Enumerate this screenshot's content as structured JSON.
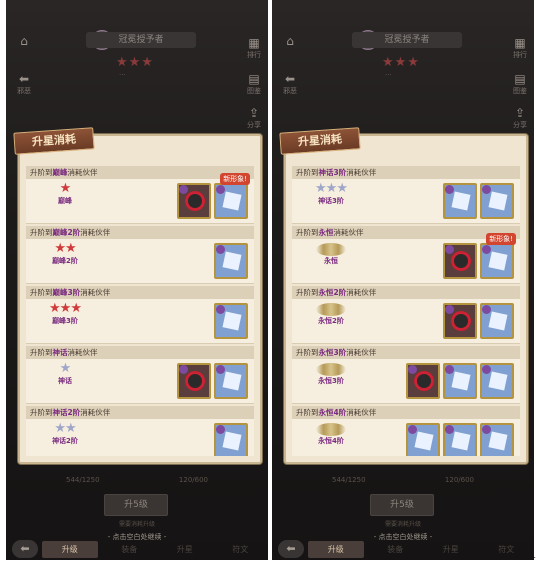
{
  "left": {
    "top_title": "冠冕授予者",
    "side_left": [
      {
        "label": "邪恶"
      }
    ],
    "side_right": [
      {
        "label": "排行"
      },
      {
        "label": "图鉴"
      },
      {
        "label": "分享"
      }
    ],
    "card_title": "升星消耗",
    "rows": [
      {
        "prefix": "升阶到",
        "rank": "巅峰",
        "suffix": "消耗伙伴",
        "stars": "★",
        "star_type": "red",
        "name": "巅峰",
        "slots": [
          "dark",
          "blue"
        ],
        "new": "新形象!"
      },
      {
        "prefix": "升阶到",
        "rank": "巅峰2阶",
        "suffix": "消耗伙伴",
        "stars": "★★",
        "star_type": "red",
        "name": "巅峰2阶",
        "slots": [
          "blue"
        ],
        "new": ""
      },
      {
        "prefix": "升阶到",
        "rank": "巅峰3阶",
        "suffix": "消耗伙伴",
        "stars": "★★★",
        "star_type": "red",
        "name": "巅峰3阶",
        "slots": [
          "blue"
        ],
        "new": ""
      },
      {
        "prefix": "升阶到",
        "rank": "神话",
        "suffix": "消耗伙伴",
        "stars": "★",
        "star_type": "silver",
        "name": "神话",
        "slots": [
          "dark",
          "blue"
        ],
        "new": ""
      },
      {
        "prefix": "升阶到",
        "rank": "神话2阶",
        "suffix": "消耗伙伴",
        "stars": "★★",
        "star_type": "silver",
        "name": "神话2阶",
        "slots": [
          "blue"
        ],
        "new": ""
      }
    ],
    "currency": [
      "544/1250",
      "120/600"
    ],
    "upgrade_label": "升5级",
    "hint": "需要消耗升级",
    "dismiss": "- 点击空白处继续 -",
    "tabs": [
      "升级",
      "装备",
      "升星",
      "符文"
    ]
  },
  "right": {
    "top_title": "冠冕授予者",
    "side_left": [
      {
        "label": "邪恶"
      }
    ],
    "side_right": [
      {
        "label": "排行"
      },
      {
        "label": "图鉴"
      },
      {
        "label": "分享"
      }
    ],
    "card_title": "升星消耗",
    "rows": [
      {
        "prefix": "升阶到",
        "rank": "神话3阶",
        "suffix": "消耗伙伴",
        "stars": "★★★",
        "star_type": "silver",
        "name": "神话3阶",
        "slots": [
          "blue",
          "blue"
        ],
        "new": "",
        "wing": false
      },
      {
        "prefix": "升阶到",
        "rank": "永恒",
        "suffix": "消耗伙伴",
        "stars": "",
        "star_type": "wing",
        "name": "永恒",
        "slots": [
          "dark",
          "blue"
        ],
        "new": "新形象!",
        "wing": true
      },
      {
        "prefix": "升阶到",
        "rank": "永恒2阶",
        "suffix": "消耗伙伴",
        "stars": "",
        "star_type": "wing",
        "name": "永恒2阶",
        "slots": [
          "dark",
          "blue"
        ],
        "new": "",
        "wing": true
      },
      {
        "prefix": "升阶到",
        "rank": "永恒3阶",
        "suffix": "消耗伙伴",
        "stars": "",
        "star_type": "wing",
        "name": "永恒3阶",
        "slots": [
          "dark",
          "blue",
          "blue"
        ],
        "new": "",
        "wing": true
      },
      {
        "prefix": "升阶到",
        "rank": "永恒4阶",
        "suffix": "消耗伙伴",
        "stars": "",
        "star_type": "wing",
        "name": "永恒4阶",
        "slots": [
          "blue",
          "blue",
          "blue"
        ],
        "new": "",
        "wing": true
      }
    ],
    "currency": [
      "544/1250",
      "120/600"
    ],
    "upgrade_label": "升5级",
    "hint": "需要消耗升级",
    "dismiss": "- 点击空白处继续 -",
    "tabs": [
      "升级",
      "装备",
      "升星",
      "符文"
    ]
  }
}
